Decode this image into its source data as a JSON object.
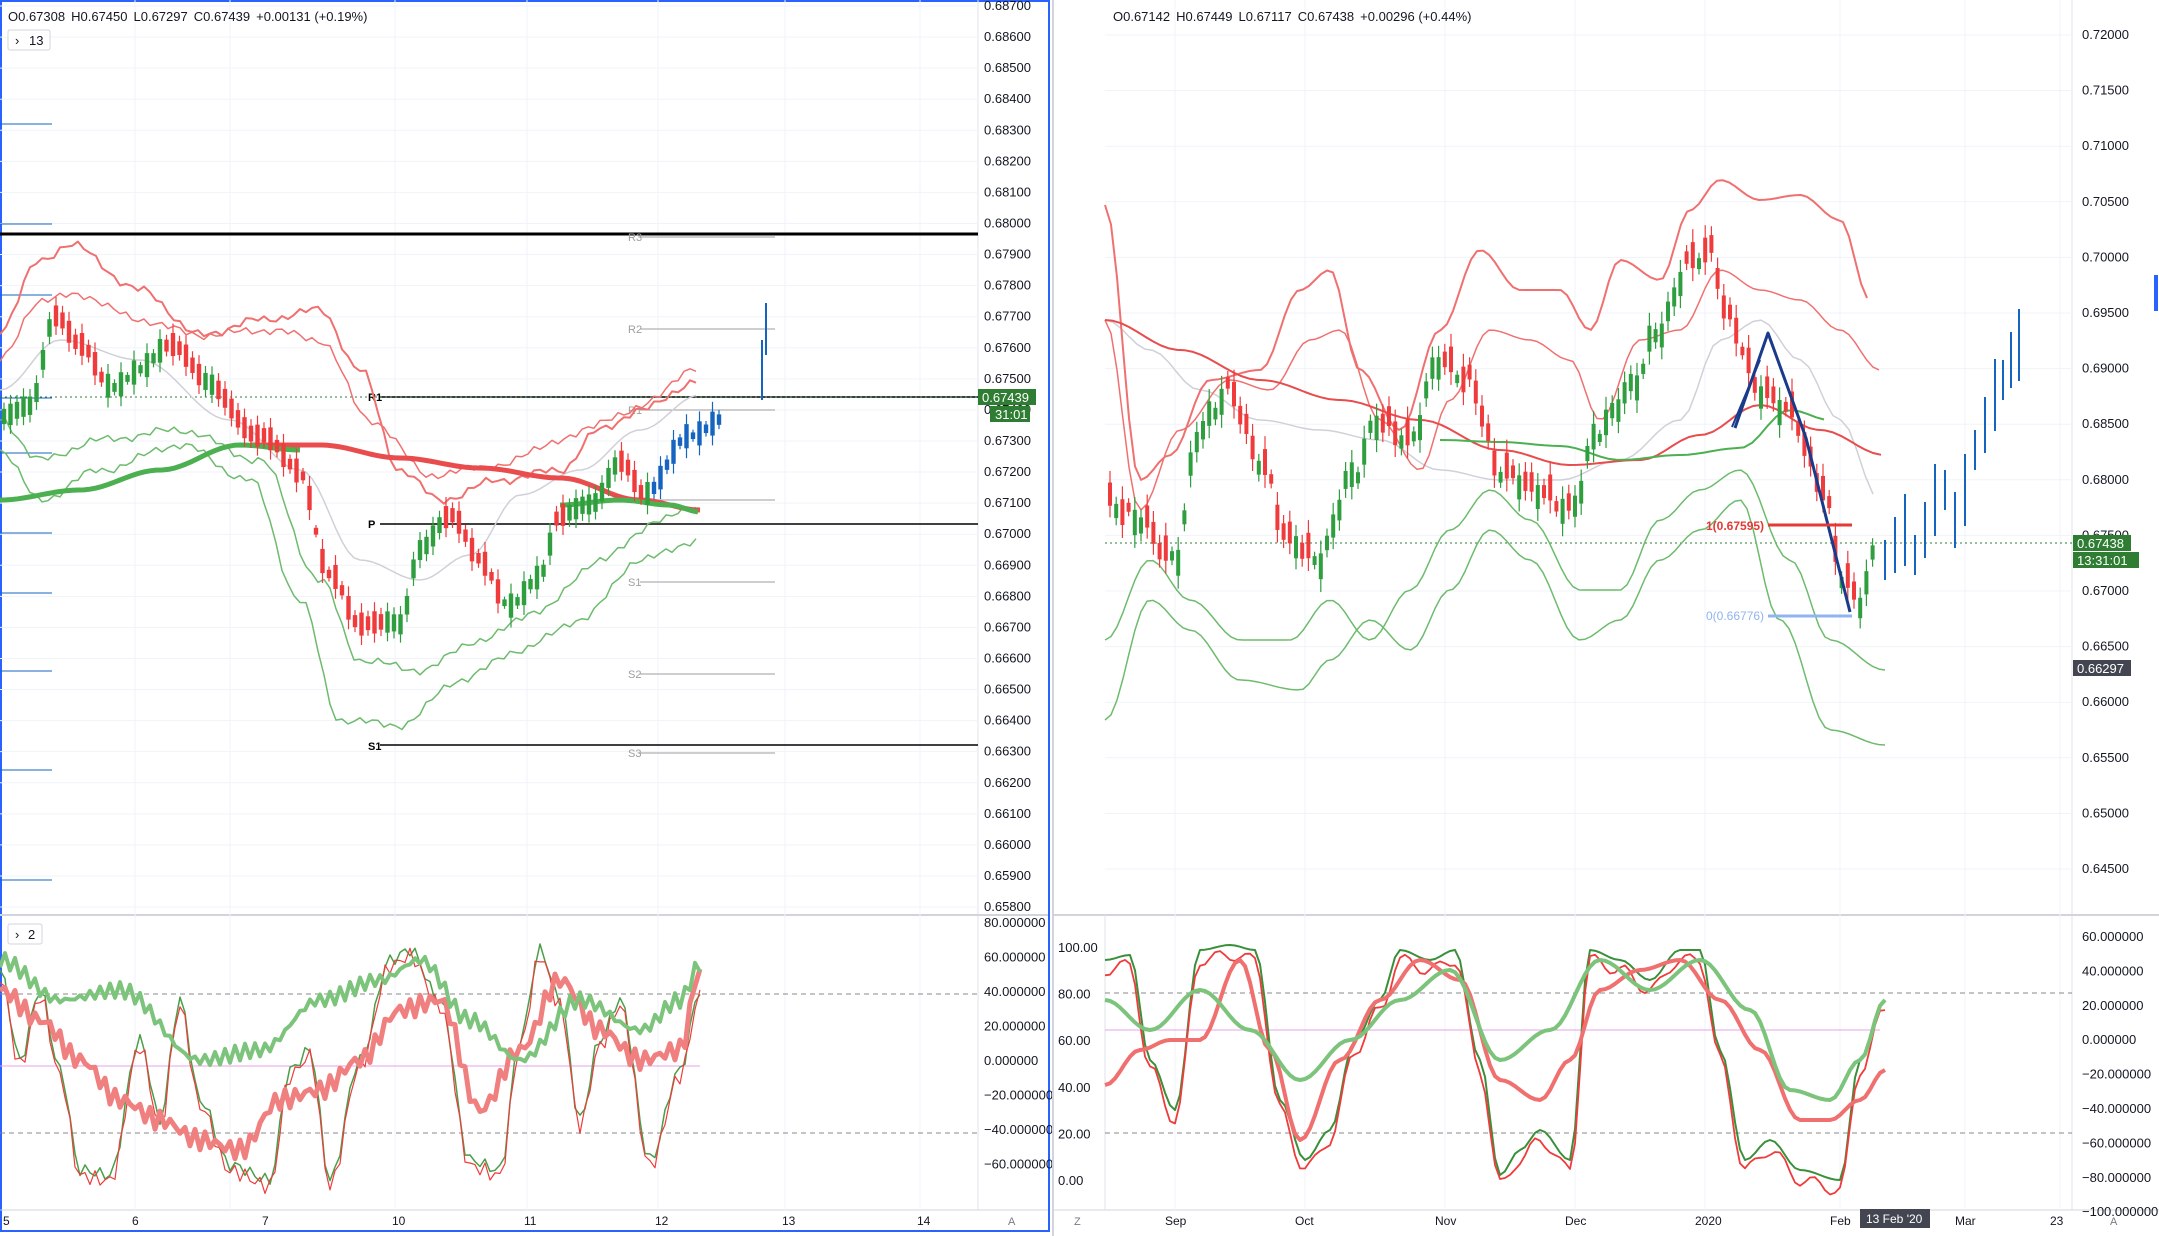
{
  "colors": {
    "up": "#26a69a",
    "upBar": "#2e9e3e",
    "down": "#ef3b3b",
    "blue": "#1565c0",
    "bandRed": "#f07070",
    "bandGreen": "#6dbb6d",
    "maRed": "#e84c4c",
    "maGreen": "#4caf50",
    "grey": "#d0d0d8",
    "pink": "#e060e0",
    "price": "#2e7d32",
    "frame": "#2962ff"
  },
  "left": {
    "ohlc": {
      "o": "O0.67308",
      "h": "H0.67450",
      "l": "L0.67297",
      "c": "C0.67439",
      "chg": "+0.00131 (+0.19%)"
    },
    "badge_top": "13",
    "badge_bottom": "2",
    "price_label": "0.67439",
    "countdown": "31:01",
    "price_ticks": [
      "0.68700",
      "0.68600",
      "0.68500",
      "0.68400",
      "0.68300",
      "0.68200",
      "0.68100",
      "0.68000",
      "0.67900",
      "0.67800",
      "0.67700",
      "0.67600",
      "0.67500",
      "0.67400",
      "0.67300",
      "0.67200",
      "0.67100",
      "0.67000",
      "0.66900",
      "0.66800",
      "0.66700",
      "0.66600",
      "0.66500",
      "0.66400",
      "0.66300",
      "0.66200",
      "0.66100",
      "0.66000",
      "0.65900",
      "0.65800"
    ],
    "osc_ticks": [
      "80.000000",
      "60.000000",
      "40.000000",
      "20.000000",
      "0.000000",
      "−20.000000",
      "−40.000000",
      "−60.000000"
    ],
    "time_ticks": [
      "5",
      "6",
      "7",
      "10",
      "11",
      "12",
      "13",
      "14"
    ],
    "axis_btn": "A",
    "levels": {
      "R3": "R3",
      "R2": "R2",
      "R1_grey": "R1",
      "R1": "R1",
      "P": "P",
      "S1_grey": "S1",
      "S2": "S2",
      "S1": "S1",
      "S3": "S3"
    }
  },
  "right": {
    "ohlc": {
      "o": "O0.67142",
      "h": "H0.67449",
      "l": "L0.67117",
      "c": "C0.67438",
      "chg": "+0.00296 (+0.44%)"
    },
    "price_label": "0.67438",
    "countdown": "13:31:01",
    "low_label": "0.66297",
    "price_ticks": [
      "0.72000",
      "0.71500",
      "0.71000",
      "0.70500",
      "0.70000",
      "0.69500",
      "0.69000",
      "0.68500",
      "0.68000",
      "0.67500",
      "0.67000",
      "0.66500",
      "0.66000",
      "0.65500",
      "0.65000",
      "0.64500"
    ],
    "osc_ticks_left": [
      "100.00",
      "80.00",
      "60.00",
      "40.00",
      "20.00",
      "0.00"
    ],
    "osc_ticks_right": [
      "60.000000",
      "40.000000",
      "20.000000",
      "0.000000",
      "−20.000000",
      "−40.000000",
      "−60.000000",
      "−80.000000",
      "−100.000000"
    ],
    "time_ticks": [
      "Sep",
      "Oct",
      "Nov",
      "Dec",
      "2020",
      "Feb",
      "Mar",
      "23"
    ],
    "date_badge": "13 Feb '20",
    "axis_btn_left": "Z",
    "axis_btn_right": "A",
    "fib1": "1(0.67595)",
    "fib0": "0(0.66776)"
  }
}
